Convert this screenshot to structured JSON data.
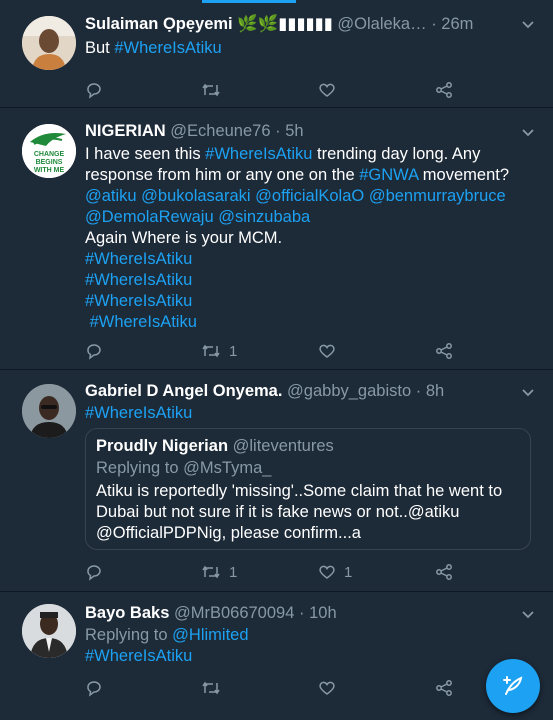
{
  "tweets": [
    {
      "name": "Sulaiman Ọpẹyemi 🌿🌿▮▮▮▮▮▮",
      "handle": "@Olaleka…",
      "time": "26m",
      "lines": [
        "But",
        "#WhereIsAtiku"
      ],
      "replies": "",
      "retweets": "",
      "likes": ""
    },
    {
      "name": "NIGERIAN",
      "handle": "@Echeune76",
      "time": "5h",
      "avatar_text": "CHANGE BEGINS WITH ME",
      "text_1": "I have seen this ",
      "hashtag_1": "#WhereIsAtiku",
      "text_2": " trending day long. Any",
      "text_3": "response from him or any one on the ",
      "hashtag_2": "#GNWA",
      "text_4": " movement?",
      "mentions_1": "@atiku @bukolasaraki @officialKolaO @benmurraybruce",
      "mentions_2": "@DemolaRewaju @sinzubaba",
      "text_5": "Again Where is your MCM.",
      "hashtags": [
        "#WhereIsAtiku",
        "#WhereIsAtiku",
        "#WhereIsAtiku",
        " #WhereIsAtiku"
      ],
      "retweets": "1"
    },
    {
      "name": "Gabriel D Angel Onyema.",
      "handle": "@gabby_gabisto",
      "time": "8h",
      "hashtag": "#WhereIsAtiku",
      "quote": {
        "name": "Proudly Nigerian",
        "handle": "@liteventures",
        "replying_to_label": "Replying to",
        "replying_to": "@MsTyma_",
        "line_1": "Atiku is reportedly 'missing'..Some claim that he went to",
        "line_2": "Dubai but not sure if it is fake news or not..@atiku",
        "line_3": "@OfficialPDPNig, please confirm...a"
      },
      "retweets": "1",
      "likes": "1"
    },
    {
      "name": "Bayo Baks",
      "handle": "@MrB06670094",
      "time": "10h",
      "replying_to_label": "Replying to",
      "replying_to": "@Hlimited",
      "hashtag": "#WhereIsAtiku"
    }
  ],
  "separator": "·",
  "icons": {
    "reply": "reply-icon",
    "retweet": "retweet-icon",
    "like": "heart-icon",
    "share": "share-icon",
    "menu": "chevron-down-icon",
    "compose": "compose-tweet-icon"
  },
  "colors": {
    "background": "#1d2a38",
    "accent": "#1da1f2",
    "muted": "#8899a6"
  }
}
